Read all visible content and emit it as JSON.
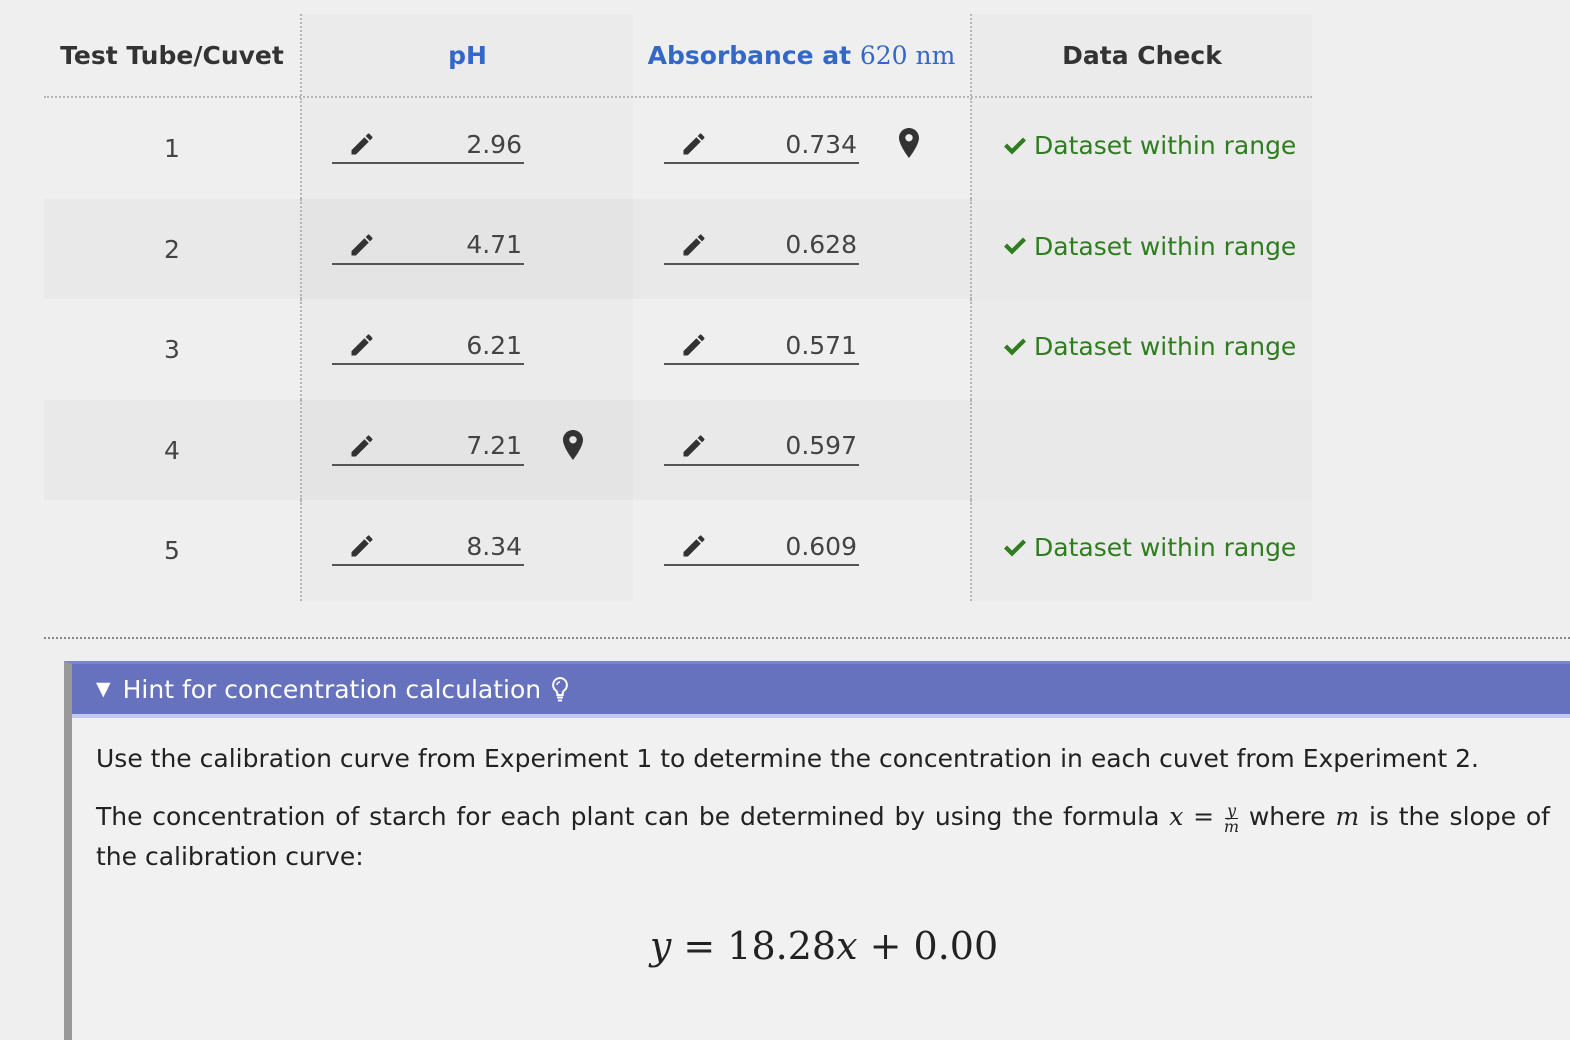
{
  "table": {
    "headers": {
      "tube": "Test Tube/Cuvet",
      "ph": "pH",
      "absorbance": "Absorbance at",
      "absorbance_unit": "620 nm",
      "check": "Data Check"
    },
    "rows": [
      {
        "tube": "1",
        "ph": "2.96",
        "absorbance": "0.734",
        "check": "Dataset within range"
      },
      {
        "tube": "2",
        "ph": "4.71",
        "absorbance": "0.628",
        "check": "Dataset within range"
      },
      {
        "tube": "3",
        "ph": "6.21",
        "absorbance": "0.571",
        "check": "Dataset within range"
      },
      {
        "tube": "4",
        "ph": "7.21",
        "absorbance": "0.597",
        "check": ""
      },
      {
        "tube": "5",
        "ph": "8.34",
        "absorbance": "0.609",
        "check": "Dataset within range"
      }
    ]
  },
  "hint": {
    "title": "Hint for concentration calculation",
    "paragraph1": "Use the calibration curve from Experiment 1 to determine the concentration in each cuvet from Experiment 2.",
    "paragraph2_before": "The concentration of starch for each plant can be determined by using the formula",
    "formula_lhs": "x =",
    "formula_num": "y",
    "formula_den": "m",
    "paragraph2_mid": "where",
    "slope_var": "m",
    "paragraph2_after": "is the slope of the calibration curve:",
    "equation": {
      "y": "y",
      "eq": " = 18.28",
      "x": "x",
      "rest": " + 0.00"
    }
  },
  "colors": {
    "header_blue": "#3468c8",
    "check_green": "#2e7d1f",
    "hint_header": "#6672bd"
  },
  "icons": {
    "edit": "pencil-icon",
    "marker": "map-marker-icon",
    "ok": "checkmark-icon",
    "hint": "lightbulb-icon"
  }
}
